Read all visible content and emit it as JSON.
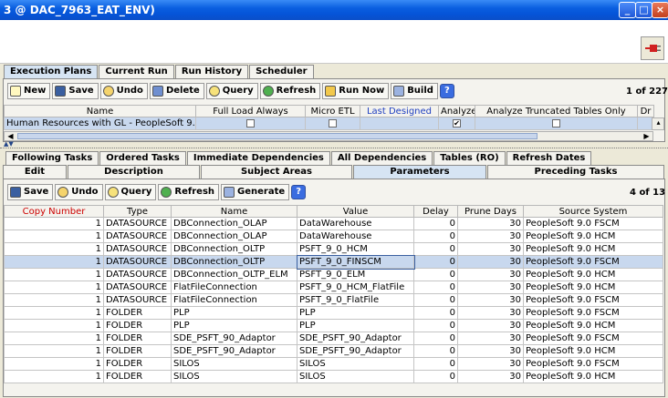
{
  "window": {
    "title": "3 @ DAC_7963_EAT_ENV)"
  },
  "top_tabs": [
    "Execution Plans",
    "Current Run",
    "Run History",
    "Scheduler"
  ],
  "plans_toolbar": {
    "buttons": [
      "New",
      "Save",
      "Undo",
      "Delete",
      "Query",
      "Refresh",
      "Run Now",
      "Build"
    ],
    "help": "?",
    "count": "1 of 227"
  },
  "plans_table": {
    "columns": [
      "Name",
      "Full Load Always",
      "Micro ETL",
      "Last Designed",
      "Analyze",
      "Analyze Truncated Tables Only",
      "Dr"
    ],
    "row": {
      "name": "Human Resources with GL - PeopleSoft 9.0",
      "full_load_always": false,
      "micro_etl": false,
      "last_designed": "",
      "analyze": true,
      "analyze_truncated": false
    }
  },
  "sub_tabs_row1": [
    "Following Tasks",
    "Ordered Tasks",
    "Immediate Dependencies",
    "All Dependencies",
    "Tables (RO)",
    "Refresh Dates"
  ],
  "sub_tabs_row2": [
    "Edit",
    "Description",
    "Subject Areas",
    "Parameters",
    "Preceding Tasks"
  ],
  "params_toolbar": {
    "buttons": [
      "Save",
      "Undo",
      "Query",
      "Refresh",
      "Generate"
    ],
    "help": "?",
    "count": "4 of 13"
  },
  "params_table": {
    "columns": [
      "Copy Number",
      "Type",
      "Name",
      "Value",
      "Delay",
      "Prune Days",
      "Source System"
    ],
    "rows": [
      [
        "1",
        "DATASOURCE",
        "DBConnection_OLAP",
        "DataWarehouse",
        "0",
        "30",
        "PeopleSoft 9.0 FSCM"
      ],
      [
        "1",
        "DATASOURCE",
        "DBConnection_OLAP",
        "DataWarehouse",
        "0",
        "30",
        "PeopleSoft 9.0 HCM"
      ],
      [
        "1",
        "DATASOURCE",
        "DBConnection_OLTP",
        "PSFT_9_0_HCM",
        "0",
        "30",
        "PeopleSoft 9.0 HCM"
      ],
      [
        "1",
        "DATASOURCE",
        "DBConnection_OLTP",
        "PSFT_9_0_FINSCM",
        "0",
        "30",
        "PeopleSoft 9.0 FSCM"
      ],
      [
        "1",
        "DATASOURCE",
        "DBConnection_OLTP_ELM",
        "PSFT_9_0_ELM",
        "0",
        "30",
        "PeopleSoft 9.0 HCM"
      ],
      [
        "1",
        "DATASOURCE",
        "FlatFileConnection",
        "PSFT_9_0_HCM_FlatFile",
        "0",
        "30",
        "PeopleSoft 9.0 HCM"
      ],
      [
        "1",
        "DATASOURCE",
        "FlatFileConnection",
        "PSFT_9_0_FlatFile",
        "0",
        "30",
        "PeopleSoft 9.0 FSCM"
      ],
      [
        "1",
        "FOLDER",
        "PLP",
        "PLP",
        "0",
        "30",
        "PeopleSoft 9.0 FSCM"
      ],
      [
        "1",
        "FOLDER",
        "PLP",
        "PLP",
        "0",
        "30",
        "PeopleSoft 9.0 HCM"
      ],
      [
        "1",
        "FOLDER",
        "SDE_PSFT_90_Adaptor",
        "SDE_PSFT_90_Adaptor",
        "0",
        "30",
        "PeopleSoft 9.0 FSCM"
      ],
      [
        "1",
        "FOLDER",
        "SDE_PSFT_90_Adaptor",
        "SDE_PSFT_90_Adaptor",
        "0",
        "30",
        "PeopleSoft 9.0 HCM"
      ],
      [
        "1",
        "FOLDER",
        "SILOS",
        "SILOS",
        "0",
        "30",
        "PeopleSoft 9.0 FSCM"
      ],
      [
        "1",
        "FOLDER",
        "SILOS",
        "SILOS",
        "0",
        "30",
        "PeopleSoft 9.0 HCM"
      ]
    ]
  },
  "colors": {
    "title_bar": "#0554D8",
    "selected_row": "#C8D8EE",
    "copy_number_header": "#CC0000",
    "last_designed_header": "#2040C0"
  }
}
